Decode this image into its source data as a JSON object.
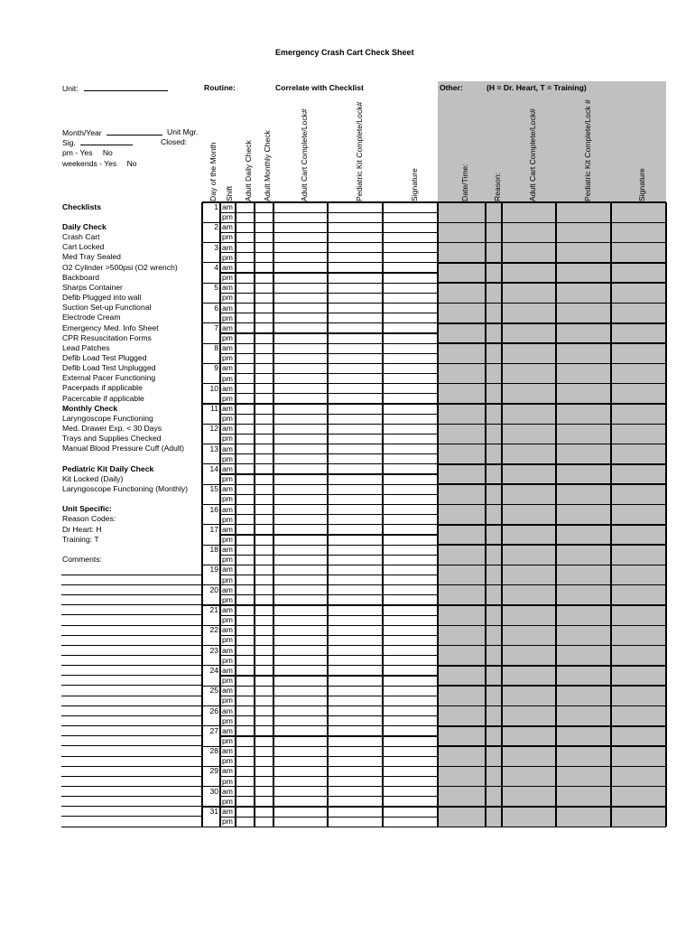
{
  "title": "Emergency Crash Cart Check Sheet",
  "header": {
    "unit_label": "Unit:",
    "routine_label": "Routine:",
    "correlate_label": "Correlate with Checklist",
    "other_label": "Other:",
    "other_legend": "(H = Dr. Heart, T = Training)"
  },
  "form_fields": {
    "month_year_label": "Month/Year",
    "unit_mgr_label": "Unit Mgr.",
    "sig_label": "Sig.",
    "closed_label": "Closed:",
    "pm_label": "pm - Yes",
    "pm_no": "No",
    "weekends_label": "weekends - Yes",
    "weekends_no": "No"
  },
  "routine_columns": [
    "Day of the Month",
    "Shift",
    "Adult Daily Check",
    "Adult Monthly Check",
    "Adult Cart Complete/Lock#",
    "Pediatric Kit Complete/Lock#",
    "Signature"
  ],
  "other_columns": [
    "Date/Time:",
    "Reason:",
    "Adult Cart Complete/Lock#",
    "Pediatric Kit Complete/Lock #",
    "Signature"
  ],
  "checklists": {
    "heading": "Checklists",
    "lines": [
      {
        "text": "Daily Check",
        "bold": true
      },
      {
        "text": "Crash Cart",
        "bold": false
      },
      {
        "text": "Cart Locked",
        "bold": false
      },
      {
        "text": "Med Tray Sealed",
        "bold": false
      },
      {
        "text": "O2 Cylinder >500psi (O2 wrench)",
        "bold": false
      },
      {
        "text": "Backboard",
        "bold": false
      },
      {
        "text": "Sharps Container",
        "bold": false
      },
      {
        "text": "Defib Plugged into wall",
        "bold": false
      },
      {
        "text": "Suction Set-up Functional",
        "bold": false
      },
      {
        "text": "Electrode Cream",
        "bold": false
      },
      {
        "text": "Emergency Med. Info Sheet",
        "bold": false
      },
      {
        "text": "CPR Resuscitation Forms",
        "bold": false
      },
      {
        "text": "Lead Patches",
        "bold": false
      },
      {
        "text": "Defib Load Test Plugged",
        "bold": false
      },
      {
        "text": "Defib Load Test Unplugged",
        "bold": false
      },
      {
        "text": "External Pacer Functioning",
        "bold": false
      },
      {
        "text": "Pacerpads if applicable",
        "bold": false
      },
      {
        "text": "Pacercable if applicable",
        "bold": false
      },
      {
        "text": "Monthly Check",
        "bold": true
      },
      {
        "text": "Laryngoscope Functioning",
        "bold": false
      },
      {
        "text": "Med. Drawer Exp. < 30 Days",
        "bold": false
      },
      {
        "text": "Trays and Supplies Checked",
        "bold": false
      },
      {
        "text": "Manual Blood Pressure Cuff (Adult)",
        "bold": false
      },
      {
        "text": "",
        "bold": false
      },
      {
        "text": "Pediatric Kit Daily Check",
        "bold": true
      },
      {
        "text": "Kit Locked (Daily)",
        "bold": false
      },
      {
        "text": "Laryngoscope Functioning (Monthly)",
        "bold": false
      },
      {
        "text": "",
        "bold": false
      },
      {
        "text": "Unit Specific:",
        "bold": true
      },
      {
        "text": "Reason Codes:",
        "bold": false
      },
      {
        "text": "Dr Heart: H",
        "bold": false
      },
      {
        "text": "Training: T",
        "bold": false
      },
      {
        "text": "",
        "bold": false
      },
      {
        "text": "Comments:",
        "bold": false
      }
    ]
  },
  "days": [
    1,
    2,
    3,
    4,
    5,
    6,
    7,
    8,
    9,
    10,
    11,
    12,
    13,
    14,
    15,
    16,
    17,
    18,
    19,
    20,
    21,
    22,
    23,
    24,
    25,
    26,
    27,
    28,
    29,
    30,
    31
  ],
  "shifts": [
    "am",
    "pm"
  ],
  "colors": {
    "gray_panel": "#c0c0c0",
    "line": "#000000"
  }
}
